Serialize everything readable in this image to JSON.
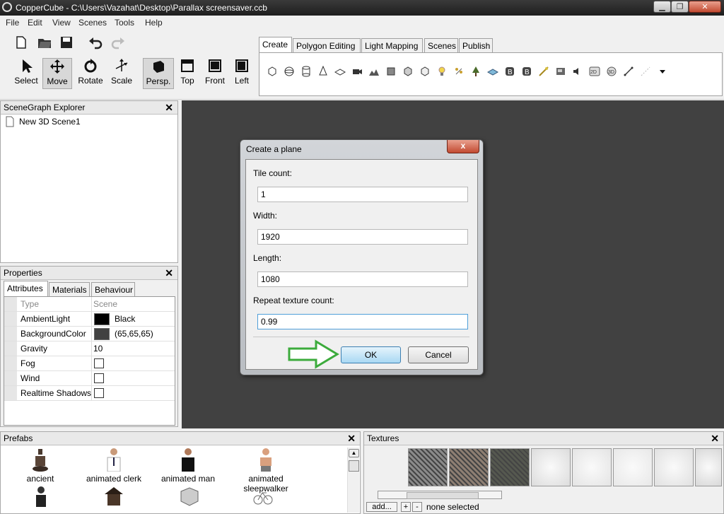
{
  "window": {
    "title": "CopperCube - C:\\Users\\Vazahat\\Desktop\\Parallax screensaver.ccb",
    "minimize": "▁",
    "maximize": "❐",
    "close": "✕"
  },
  "menu": [
    "File",
    "Edit",
    "View",
    "Scenes",
    "Tools",
    "Help"
  ],
  "toolbar": {
    "tools": [
      {
        "label": "Select",
        "icon": "cursor-icon"
      },
      {
        "label": "Move",
        "icon": "move-icon"
      },
      {
        "label": "Rotate",
        "icon": "rotate-icon"
      },
      {
        "label": "Scale",
        "icon": "scale-icon"
      },
      {
        "label": "Persp.",
        "icon": "perspective-icon"
      },
      {
        "label": "Top",
        "icon": "top-view-icon"
      },
      {
        "label": "Front",
        "icon": "front-view-icon"
      },
      {
        "label": "Left",
        "icon": "left-view-icon"
      }
    ],
    "file_icons": [
      "new-file-icon",
      "open-folder-icon",
      "save-icon",
      "undo-icon",
      "redo-icon"
    ]
  },
  "tabs": [
    "Create",
    "Polygon Editing",
    "Light Mapping",
    "Scenes",
    "Publish"
  ],
  "create_icons": [
    "cube-icon",
    "sphere-icon",
    "cylinder-icon",
    "cone-icon",
    "plane-icon",
    "camera-icon",
    "terrain-icon",
    "billboard-icon",
    "skybox-icon",
    "mesh-icon",
    "light-icon",
    "particle-icon",
    "tree-icon",
    "water-icon",
    "button-b-icon",
    "button-b2-icon",
    "path-icon",
    "overlay-icon",
    "sound-icon",
    "2d-icon",
    "3d-icon",
    "line-icon",
    "dots-icon",
    "dropdown-icon"
  ],
  "scenegraph": {
    "title": "SceneGraph Explorer",
    "items": [
      "New 3D Scene1"
    ]
  },
  "properties": {
    "title": "Properties",
    "tabs": [
      "Attributes",
      "Materials",
      "Behaviour"
    ],
    "rows": [
      {
        "name": "Type",
        "value": "Scene"
      },
      {
        "name": "AmbientLight",
        "value": "Black",
        "swatch": "#000000"
      },
      {
        "name": "BackgroundColor",
        "value": "(65,65,65)",
        "swatch": "#414141"
      },
      {
        "name": "Gravity",
        "value": "10"
      },
      {
        "name": "Fog",
        "value": ""
      },
      {
        "name": "Wind",
        "value": ""
      },
      {
        "name": "Realtime Shadows",
        "value": ""
      }
    ]
  },
  "dialog": {
    "title": "Create a plane",
    "close": "x",
    "fields": [
      {
        "label": "Tile count:",
        "value": "1"
      },
      {
        "label": "Width:",
        "value": "1920"
      },
      {
        "label": "Length:",
        "value": "1080"
      },
      {
        "label": "Repeat texture count:",
        "value": "0.99"
      }
    ],
    "ok": "OK",
    "cancel": "Cancel"
  },
  "prefabs": {
    "title": "Prefabs",
    "items": [
      "ancient",
      "animated clerk",
      "animated man",
      "animated sleepwalker"
    ]
  },
  "textures": {
    "title": "Textures",
    "add": "add...",
    "plus": "+",
    "minus": "-",
    "status": "none selected"
  },
  "colors": {
    "viewport": "#414141",
    "arrow": "#3cab3c"
  }
}
